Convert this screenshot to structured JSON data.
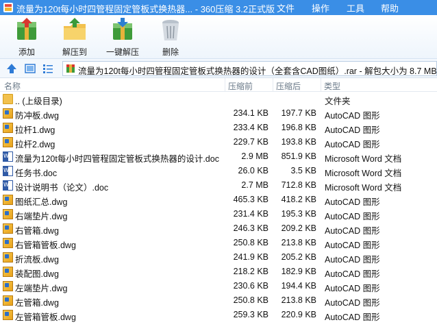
{
  "window": {
    "title": "流量为120t每小时四管程固定管板式换热器... - 360压缩 3.2正式版"
  },
  "menu": [
    "文件",
    "操作",
    "工具",
    "帮助"
  ],
  "toolbar": {
    "buttons": [
      {
        "label": "添加",
        "icon": "add-archive-icon"
      },
      {
        "label": "解压到",
        "icon": "extract-folder-icon"
      },
      {
        "label": "一键解压",
        "icon": "one-click-extract-icon"
      },
      {
        "label": "删除",
        "icon": "trash-can-icon"
      }
    ]
  },
  "address": {
    "path": "流量为120t每小时四管程固定管板式换热器的设计（全套含CAD图纸）.rar - 解包大小为 8.7 MB"
  },
  "columns": {
    "name": "名称",
    "packed": "压缩前",
    "original": "压缩后",
    "type": "类型"
  },
  "files": [
    {
      "name": ".. (上级目录)",
      "packed": "",
      "original": "",
      "type": "文件夹",
      "icon": "folder-icon"
    },
    {
      "name": "防冲板.dwg",
      "packed": "234.1 KB",
      "original": "197.7 KB",
      "type": "AutoCAD 图形",
      "icon": "dwg-file-icon"
    },
    {
      "name": "拉杆1.dwg",
      "packed": "233.4 KB",
      "original": "196.8 KB",
      "type": "AutoCAD 图形",
      "icon": "dwg-file-icon"
    },
    {
      "name": "拉杆2.dwg",
      "packed": "229.7 KB",
      "original": "193.8 KB",
      "type": "AutoCAD 图形",
      "icon": "dwg-file-icon"
    },
    {
      "name": "流量为120t每小时四管程固定管板式换热器的设计.doc",
      "packed": "2.9 MB",
      "original": "851.9 KB",
      "type": "Microsoft Word 文档",
      "icon": "word-doc-icon"
    },
    {
      "name": "任务书.doc",
      "packed": "26.0 KB",
      "original": "3.5 KB",
      "type": "Microsoft Word 文档",
      "icon": "word-doc-icon"
    },
    {
      "name": "设计说明书（论文）.doc",
      "packed": "2.7 MB",
      "original": "712.8 KB",
      "type": "Microsoft Word 文档",
      "icon": "word-doc-icon"
    },
    {
      "name": "图纸汇总.dwg",
      "packed": "465.3 KB",
      "original": "418.2 KB",
      "type": "AutoCAD 图形",
      "icon": "dwg-file-icon"
    },
    {
      "name": "右端垫片.dwg",
      "packed": "231.4 KB",
      "original": "195.3 KB",
      "type": "AutoCAD 图形",
      "icon": "dwg-file-icon"
    },
    {
      "name": "右管箱.dwg",
      "packed": "246.3 KB",
      "original": "209.2 KB",
      "type": "AutoCAD 图形",
      "icon": "dwg-file-icon"
    },
    {
      "name": "右管箱管板.dwg",
      "packed": "250.8 KB",
      "original": "213.8 KB",
      "type": "AutoCAD 图形",
      "icon": "dwg-file-icon"
    },
    {
      "name": "折流板.dwg",
      "packed": "241.9 KB",
      "original": "205.2 KB",
      "type": "AutoCAD 图形",
      "icon": "dwg-file-icon"
    },
    {
      "name": "装配图.dwg",
      "packed": "218.2 KB",
      "original": "182.9 KB",
      "type": "AutoCAD 图形",
      "icon": "dwg-file-icon"
    },
    {
      "name": "左端垫片.dwg",
      "packed": "230.6 KB",
      "original": "194.4 KB",
      "type": "AutoCAD 图形",
      "icon": "dwg-file-icon"
    },
    {
      "name": "左管箱.dwg",
      "packed": "250.8 KB",
      "original": "213.8 KB",
      "type": "AutoCAD 图形",
      "icon": "dwg-file-icon"
    },
    {
      "name": "左管箱管板.dwg",
      "packed": "259.3 KB",
      "original": "220.9 KB",
      "type": "AutoCAD 图形",
      "icon": "dwg-file-icon"
    }
  ],
  "colors": {
    "titlebar": "#3a8ee6",
    "toolbar_bg": "#eef5fc",
    "header_text": "#6b7a89"
  }
}
